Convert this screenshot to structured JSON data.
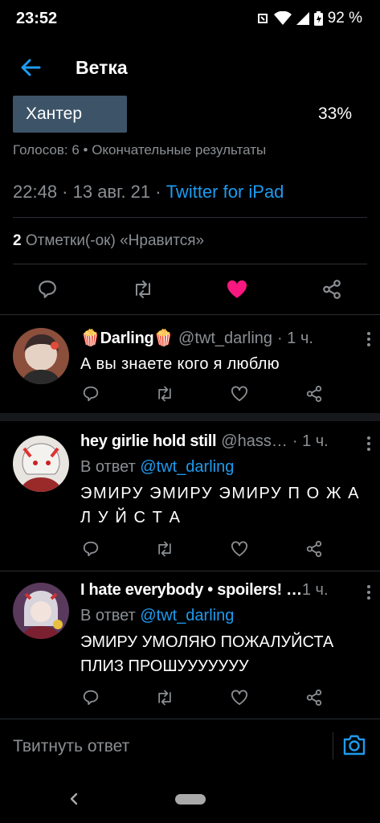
{
  "status_bar": {
    "time": "23:52",
    "battery": "92 %",
    "icons": [
      "nfc-icon",
      "wifi-icon",
      "signal-icon",
      "battery-icon"
    ]
  },
  "header": {
    "title": "Ветка",
    "back_icon": "arrow-left-icon",
    "accent_color": "#1d9bf0"
  },
  "poll": {
    "option_label": "Хантер",
    "percent_text": "33%",
    "percent_value": 0.33,
    "meta": "Голосов: 6 • Окончательные результаты"
  },
  "tweet": {
    "datetime": "22:48 · 13 авг. 21 · ",
    "source": "Twitter for iPad",
    "likes_count": "2",
    "likes_label": " Отметки(-ок) «Нравится»",
    "liked": true,
    "like_color": "#f91880"
  },
  "replies": [
    {
      "name": "🍿Darling🍿",
      "handle": "@twt_darling",
      "time": "· 1 ч.",
      "reply_to_prefix": "",
      "reply_to": "",
      "text": "А вы знаете кого я люблю"
    },
    {
      "name": "hey girlie hold still",
      "handle": "@hass…",
      "time": "· 1 ч.",
      "reply_to_prefix": "В ответ ",
      "reply_to": "@twt_darling",
      "text": "ЭМИРУ ЭМИРУ ЭМИРУ П О Ж А Л У Й С Т А"
    },
    {
      "name": "I hate everybody • spoilers! …",
      "handle": "",
      "time": "1 ч.",
      "reply_to_prefix": "В ответ ",
      "reply_to": "@twt_darling",
      "text": "ЭМИРУ УМОЛЯЮ ПОЖАЛУЙСТА ПЛИЗ ПРОШУУУУУУУ"
    }
  ],
  "compose": {
    "placeholder": "Твитнуть ответ",
    "camera_icon": "camera-icon"
  },
  "navbar": {
    "back_icon": "chevron-left-icon",
    "home_icon": "home-pill-icon"
  }
}
